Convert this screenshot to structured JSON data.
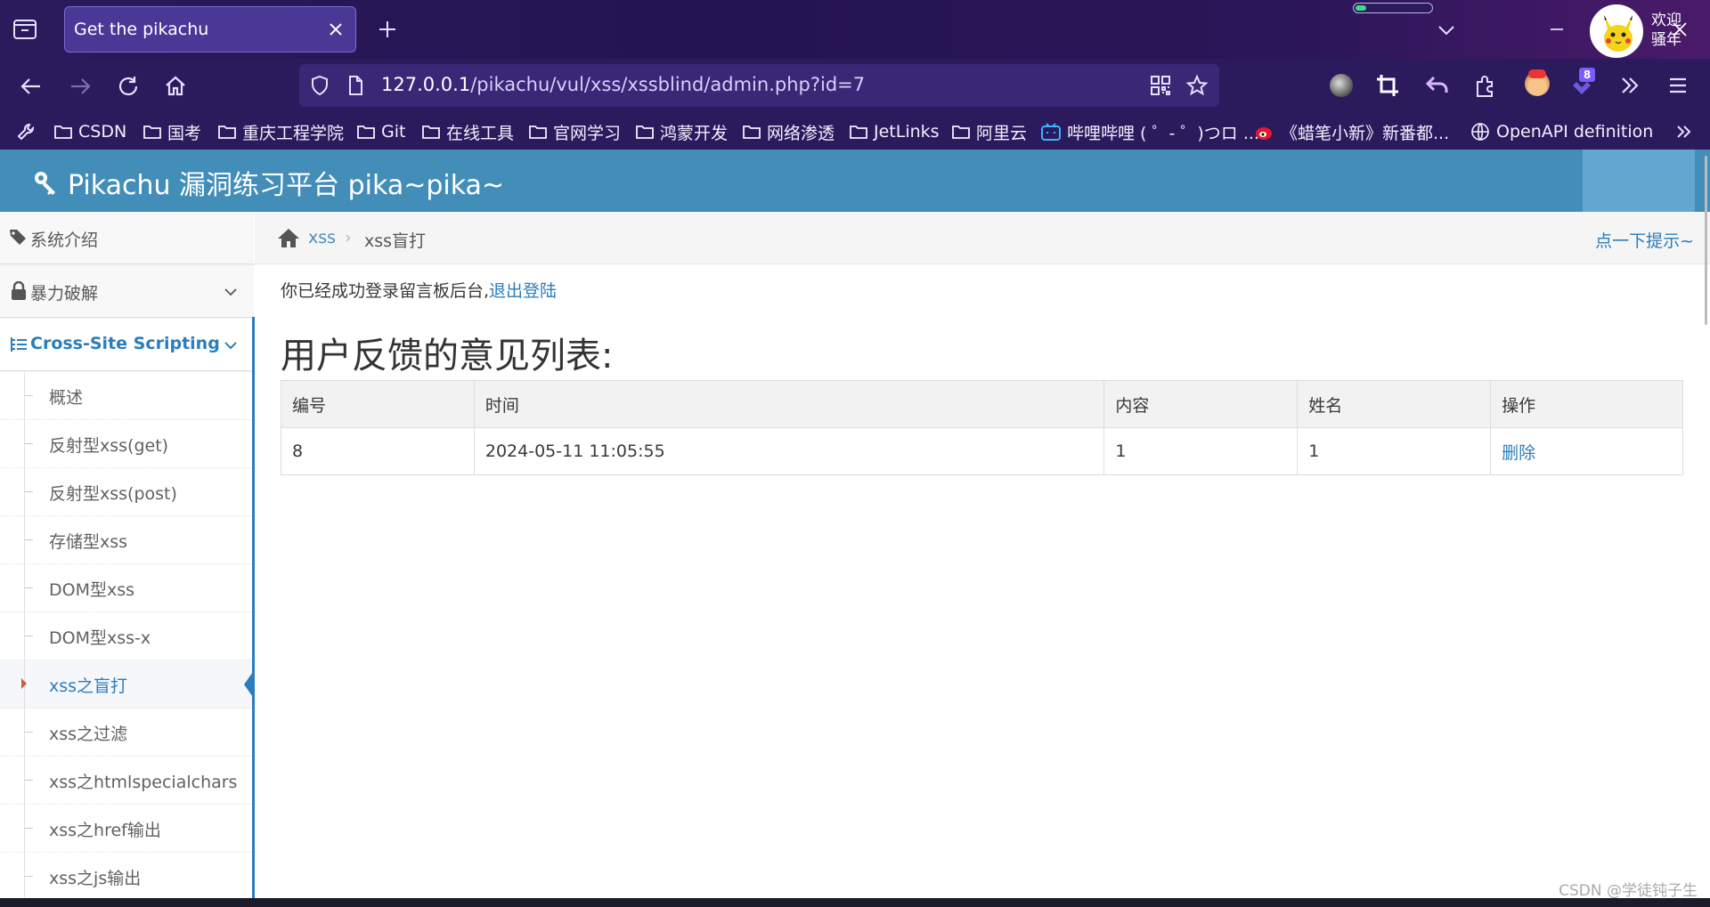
{
  "browser": {
    "tab_title": "Get the pikachu",
    "url_host": "127.0.0.1",
    "url_path": "/pikachu/vul/xss/xssblind/admin.php?id=7",
    "extension_badge": "8",
    "bookmarks": [
      {
        "label": "CSDN",
        "icon": "folder-icon"
      },
      {
        "label": "国考",
        "icon": "folder-icon"
      },
      {
        "label": "重庆工程学院",
        "icon": "folder-icon"
      },
      {
        "label": "Git",
        "icon": "folder-icon"
      },
      {
        "label": "在线工具",
        "icon": "folder-icon"
      },
      {
        "label": "官网学习",
        "icon": "folder-icon"
      },
      {
        "label": "鸿蒙开发",
        "icon": "folder-icon"
      },
      {
        "label": "网络渗透",
        "icon": "folder-icon"
      },
      {
        "label": "JetLinks",
        "icon": "folder-icon"
      },
      {
        "label": "阿里云",
        "icon": "folder-icon"
      },
      {
        "label": "哔哩哔哩 ( ゜- ゜)つロ ...",
        "icon": "bilibili-icon"
      },
      {
        "label": "《蜡笔小新》新番都...",
        "icon": "weibo-icon"
      },
      {
        "label": "OpenAPI definition",
        "icon": "globe-icon"
      }
    ],
    "colors": {
      "chrome": "#2b1a5c",
      "tab_active": "#4a3896",
      "urlbar": "#3a2775"
    }
  },
  "header": {
    "brand": "Pikachu 漏洞练习平台 pika~pika~",
    "welcome_line1": "欢迎",
    "welcome_line2": "骚年",
    "color": "#438eb9"
  },
  "sidebar": {
    "top_items": [
      {
        "label": "系统介绍",
        "icon": "tags-icon"
      },
      {
        "label": "暴力破解",
        "icon": "lock-icon"
      },
      {
        "label": "Cross-Site Scripting",
        "icon": "list-icon"
      }
    ],
    "sub_items": [
      {
        "label": "概述"
      },
      {
        "label": "反射型xss(get)"
      },
      {
        "label": "反射型xss(post)"
      },
      {
        "label": "存储型xss"
      },
      {
        "label": "DOM型xss"
      },
      {
        "label": "DOM型xss-x"
      },
      {
        "label": "xss之盲打"
      },
      {
        "label": "xss之过滤"
      },
      {
        "label": "xss之htmlspecialchars"
      },
      {
        "label": "xss之href输出"
      },
      {
        "label": "xss之js输出"
      }
    ],
    "active_sub": "xss之盲打"
  },
  "breadcrumb": {
    "level1": "xss",
    "separator": "›",
    "level2": "xss盲打",
    "hint": "点一下提示~"
  },
  "main": {
    "login_msg": "你已经成功登录留言板后台,",
    "logout_link": "退出登陆",
    "title": "用户反馈的意见列表:",
    "table": {
      "headers": [
        "编号",
        "时间",
        "内容",
        "姓名",
        "操作"
      ],
      "rows": [
        {
          "id": "8",
          "time": "2024-05-11 11:05:55",
          "content": "1",
          "name": "1",
          "action": "删除"
        }
      ]
    }
  },
  "watermark": "CSDN @学徒钝子生"
}
